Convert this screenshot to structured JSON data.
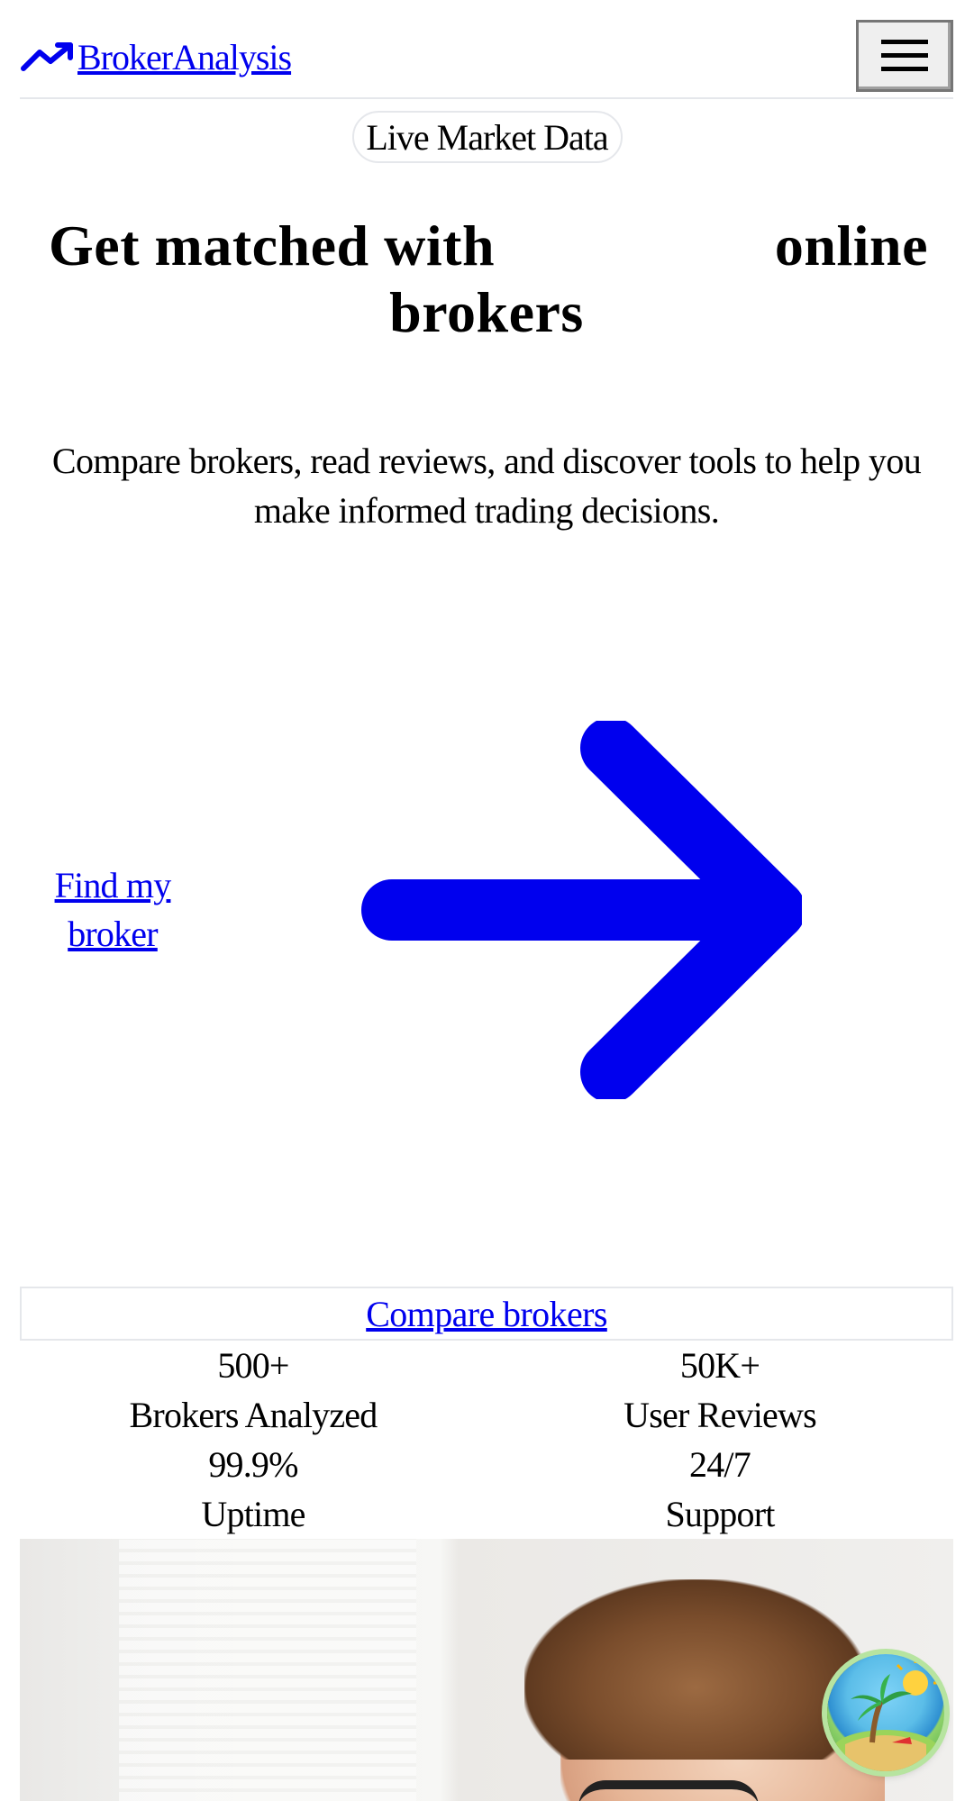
{
  "brand": {
    "name": "BrokerAnalysis",
    "icon": "trending-up-icon",
    "accent": "#0000ee"
  },
  "header": {
    "menu_icon": "hamburger-menu-icon"
  },
  "badge": {
    "label": "Live Market Data"
  },
  "hero": {
    "title_start": "Get matched with",
    "title_end": "online",
    "title_line2": "brokers",
    "subtitle": "Compare brokers, read reviews, and discover tools to help you make informed trading decisions."
  },
  "cta": {
    "find_label": "Find my broker",
    "arrow_icon": "arrow-right-icon",
    "compare_label": "Compare brokers"
  },
  "stats": [
    {
      "value": "500+",
      "label": "Brokers Analyzed"
    },
    {
      "value": "50K+",
      "label": "User Reviews"
    },
    {
      "value": "99.9%",
      "label": "Uptime"
    },
    {
      "value": "24/7",
      "label": "Support"
    }
  ],
  "floating": {
    "icon": "beach-island-icon"
  }
}
